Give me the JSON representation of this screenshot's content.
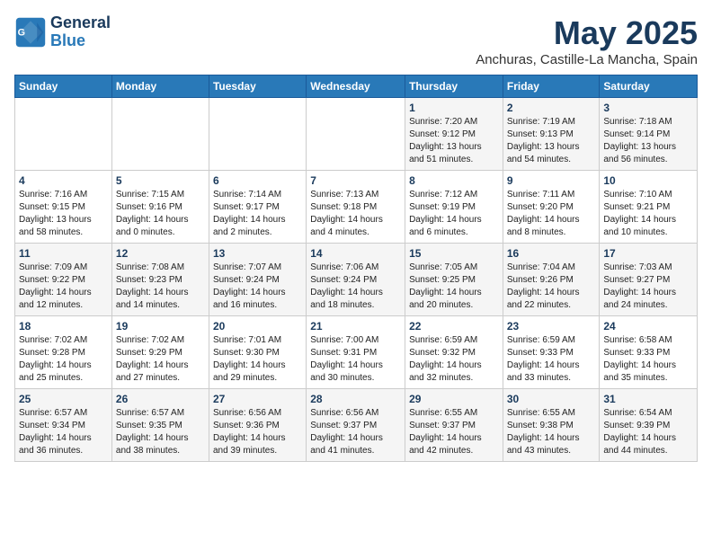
{
  "logo": {
    "line1": "General",
    "line2": "Blue"
  },
  "title": "May 2025",
  "subtitle": "Anchuras, Castille-La Mancha, Spain",
  "days_of_week": [
    "Sunday",
    "Monday",
    "Tuesday",
    "Wednesday",
    "Thursday",
    "Friday",
    "Saturday"
  ],
  "weeks": [
    [
      {
        "day": "",
        "info": ""
      },
      {
        "day": "",
        "info": ""
      },
      {
        "day": "",
        "info": ""
      },
      {
        "day": "",
        "info": ""
      },
      {
        "day": "1",
        "info": "Sunrise: 7:20 AM\nSunset: 9:12 PM\nDaylight: 13 hours\nand 51 minutes."
      },
      {
        "day": "2",
        "info": "Sunrise: 7:19 AM\nSunset: 9:13 PM\nDaylight: 13 hours\nand 54 minutes."
      },
      {
        "day": "3",
        "info": "Sunrise: 7:18 AM\nSunset: 9:14 PM\nDaylight: 13 hours\nand 56 minutes."
      }
    ],
    [
      {
        "day": "4",
        "info": "Sunrise: 7:16 AM\nSunset: 9:15 PM\nDaylight: 13 hours\nand 58 minutes."
      },
      {
        "day": "5",
        "info": "Sunrise: 7:15 AM\nSunset: 9:16 PM\nDaylight: 14 hours\nand 0 minutes."
      },
      {
        "day": "6",
        "info": "Sunrise: 7:14 AM\nSunset: 9:17 PM\nDaylight: 14 hours\nand 2 minutes."
      },
      {
        "day": "7",
        "info": "Sunrise: 7:13 AM\nSunset: 9:18 PM\nDaylight: 14 hours\nand 4 minutes."
      },
      {
        "day": "8",
        "info": "Sunrise: 7:12 AM\nSunset: 9:19 PM\nDaylight: 14 hours\nand 6 minutes."
      },
      {
        "day": "9",
        "info": "Sunrise: 7:11 AM\nSunset: 9:20 PM\nDaylight: 14 hours\nand 8 minutes."
      },
      {
        "day": "10",
        "info": "Sunrise: 7:10 AM\nSunset: 9:21 PM\nDaylight: 14 hours\nand 10 minutes."
      }
    ],
    [
      {
        "day": "11",
        "info": "Sunrise: 7:09 AM\nSunset: 9:22 PM\nDaylight: 14 hours\nand 12 minutes."
      },
      {
        "day": "12",
        "info": "Sunrise: 7:08 AM\nSunset: 9:23 PM\nDaylight: 14 hours\nand 14 minutes."
      },
      {
        "day": "13",
        "info": "Sunrise: 7:07 AM\nSunset: 9:24 PM\nDaylight: 14 hours\nand 16 minutes."
      },
      {
        "day": "14",
        "info": "Sunrise: 7:06 AM\nSunset: 9:24 PM\nDaylight: 14 hours\nand 18 minutes."
      },
      {
        "day": "15",
        "info": "Sunrise: 7:05 AM\nSunset: 9:25 PM\nDaylight: 14 hours\nand 20 minutes."
      },
      {
        "day": "16",
        "info": "Sunrise: 7:04 AM\nSunset: 9:26 PM\nDaylight: 14 hours\nand 22 minutes."
      },
      {
        "day": "17",
        "info": "Sunrise: 7:03 AM\nSunset: 9:27 PM\nDaylight: 14 hours\nand 24 minutes."
      }
    ],
    [
      {
        "day": "18",
        "info": "Sunrise: 7:02 AM\nSunset: 9:28 PM\nDaylight: 14 hours\nand 25 minutes."
      },
      {
        "day": "19",
        "info": "Sunrise: 7:02 AM\nSunset: 9:29 PM\nDaylight: 14 hours\nand 27 minutes."
      },
      {
        "day": "20",
        "info": "Sunrise: 7:01 AM\nSunset: 9:30 PM\nDaylight: 14 hours\nand 29 minutes."
      },
      {
        "day": "21",
        "info": "Sunrise: 7:00 AM\nSunset: 9:31 PM\nDaylight: 14 hours\nand 30 minutes."
      },
      {
        "day": "22",
        "info": "Sunrise: 6:59 AM\nSunset: 9:32 PM\nDaylight: 14 hours\nand 32 minutes."
      },
      {
        "day": "23",
        "info": "Sunrise: 6:59 AM\nSunset: 9:33 PM\nDaylight: 14 hours\nand 33 minutes."
      },
      {
        "day": "24",
        "info": "Sunrise: 6:58 AM\nSunset: 9:33 PM\nDaylight: 14 hours\nand 35 minutes."
      }
    ],
    [
      {
        "day": "25",
        "info": "Sunrise: 6:57 AM\nSunset: 9:34 PM\nDaylight: 14 hours\nand 36 minutes."
      },
      {
        "day": "26",
        "info": "Sunrise: 6:57 AM\nSunset: 9:35 PM\nDaylight: 14 hours\nand 38 minutes."
      },
      {
        "day": "27",
        "info": "Sunrise: 6:56 AM\nSunset: 9:36 PM\nDaylight: 14 hours\nand 39 minutes."
      },
      {
        "day": "28",
        "info": "Sunrise: 6:56 AM\nSunset: 9:37 PM\nDaylight: 14 hours\nand 41 minutes."
      },
      {
        "day": "29",
        "info": "Sunrise: 6:55 AM\nSunset: 9:37 PM\nDaylight: 14 hours\nand 42 minutes."
      },
      {
        "day": "30",
        "info": "Sunrise: 6:55 AM\nSunset: 9:38 PM\nDaylight: 14 hours\nand 43 minutes."
      },
      {
        "day": "31",
        "info": "Sunrise: 6:54 AM\nSunset: 9:39 PM\nDaylight: 14 hours\nand 44 minutes."
      }
    ]
  ]
}
